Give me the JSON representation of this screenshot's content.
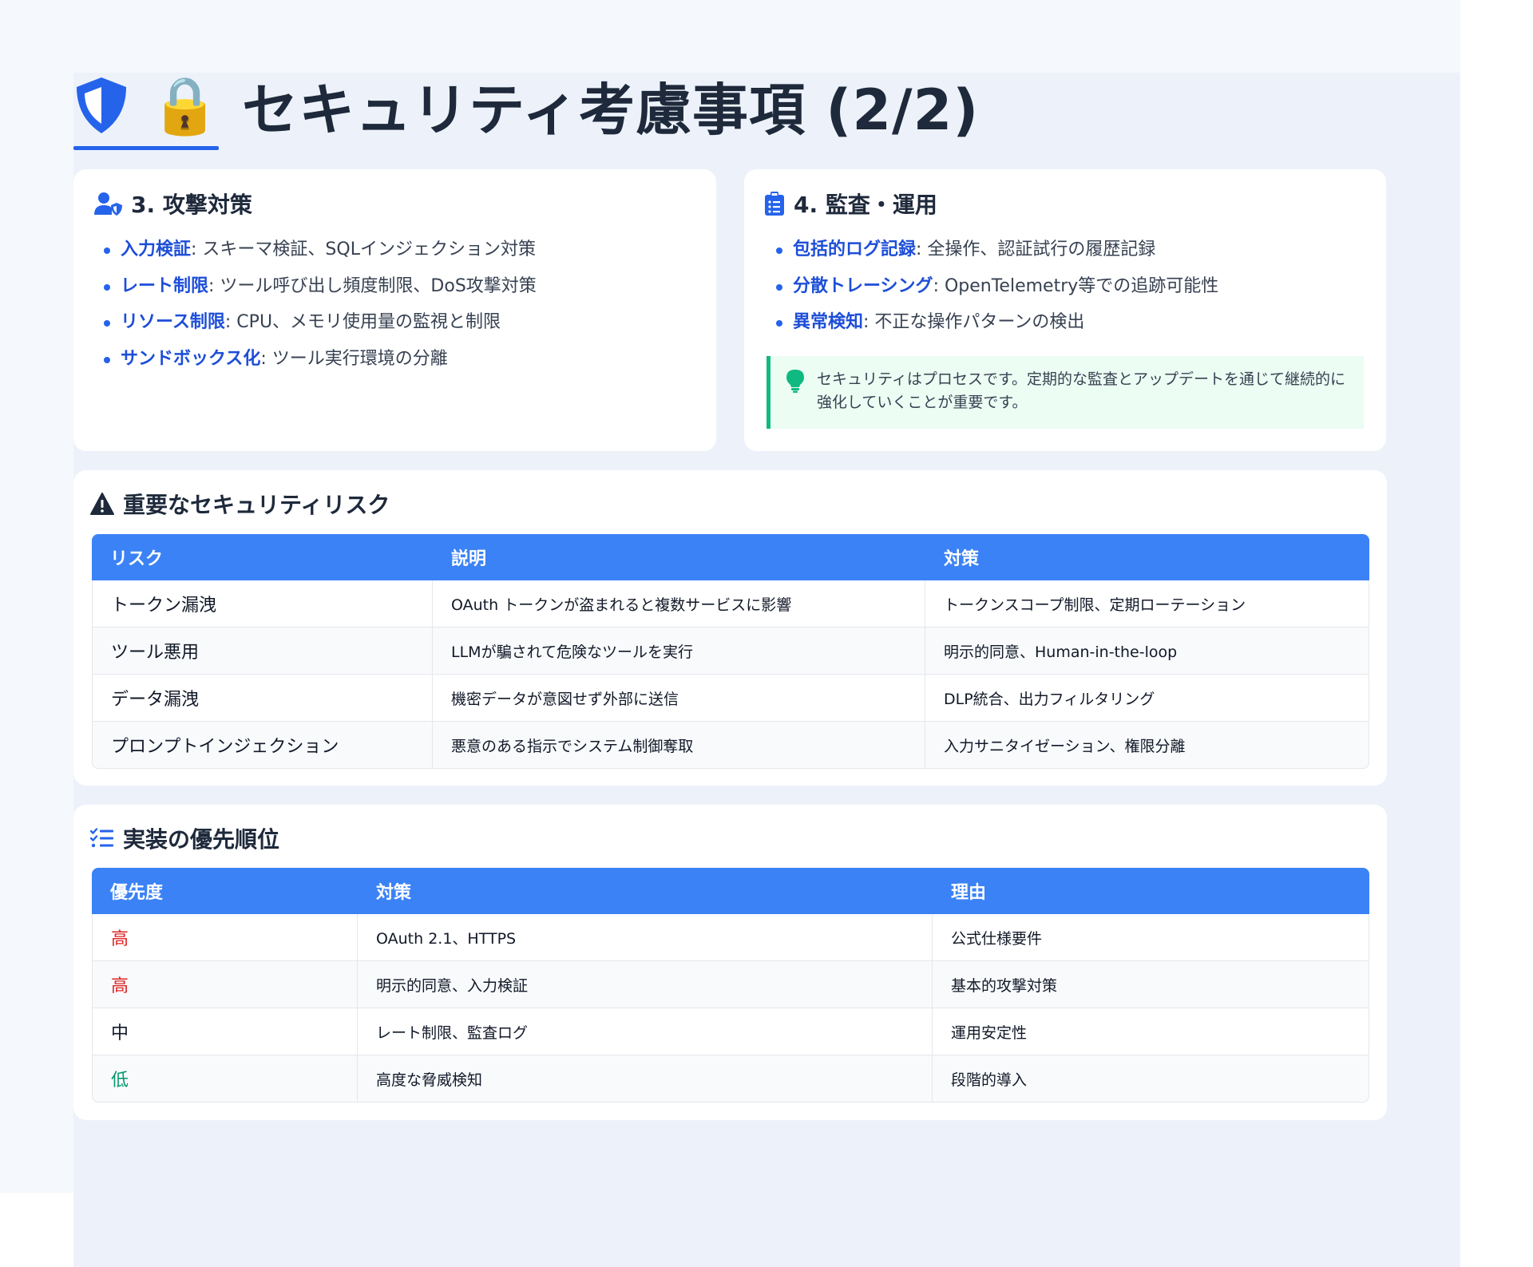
{
  "page": {
    "title": "セキュリティ考慮事項 (2/2)",
    "title_icons": [
      "shield-icon",
      "lock-icon"
    ],
    "lock_glyph": "🔒",
    "accent_color": "#2563eb",
    "header_color": "#3b82f6"
  },
  "attack": {
    "heading": "3. 攻撃対策",
    "icon": "user-shield-icon",
    "items": [
      {
        "key": "入力検証",
        "text": ": スキーマ検証、SQLインジェクション対策"
      },
      {
        "key": "レート制限",
        "text": ": ツール呼び出し頻度制限、DoS攻撃対策"
      },
      {
        "key": "リソース制限",
        "text": ": CPU、メモリ使用量の監視と制限"
      },
      {
        "key": "サンドボックス化",
        "text": ": ツール実行環境の分離"
      }
    ]
  },
  "audit": {
    "heading": "4. 監査・運用",
    "icon": "clipboard-list-icon",
    "items": [
      {
        "key": "包括的ログ記録",
        "text": ": 全操作、認証試行の履歴記録"
      },
      {
        "key": "分散トレーシング",
        "text": ": OpenTelemetry等での追跡可能性"
      },
      {
        "key": "異常検知",
        "text": ": 不正な操作パターンの検出"
      }
    ],
    "tip": "セキュリティはプロセスです。定期的な監査とアップデートを通じて継続的に強化していくことが重要です。",
    "tip_icon": "lightbulb-icon",
    "tip_color": "#10b981"
  },
  "risks": {
    "heading": "重要なセキュリティリスク",
    "icon": "warning-icon",
    "columns": [
      "リスク",
      "説明",
      "対策"
    ],
    "rows": [
      [
        "トークン漏洩",
        "OAuth トークンが盗まれると複数サービスに影響",
        "トークンスコープ制限、定期ローテーション"
      ],
      [
        "ツール悪用",
        "LLMが騙されて危険なツールを実行",
        "明示的同意、Human-in-the-loop"
      ],
      [
        "データ漏洩",
        "機密データが意図せず外部に送信",
        "DLP統合、出力フィルタリング"
      ],
      [
        "プロンプトインジェクション",
        "悪意のある指示でシステム制御奪取",
        "入力サニタイゼーション、権限分離"
      ]
    ]
  },
  "priority": {
    "heading": "実装の優先順位",
    "icon": "list-check-icon",
    "columns": [
      "優先度",
      "対策",
      "理由"
    ],
    "rows": [
      [
        "高",
        "OAuth 2.1、HTTPS",
        "公式仕様要件"
      ],
      [
        "高",
        "明示的同意、入力検証",
        "基本的攻撃対策"
      ],
      [
        "中",
        "レート制限、監査ログ",
        "運用安定性"
      ],
      [
        "低",
        "高度な脅威検知",
        "段階的導入"
      ]
    ],
    "level_colors": {
      "高": "#dc2626",
      "中": "#111827",
      "低": "#059669"
    }
  }
}
